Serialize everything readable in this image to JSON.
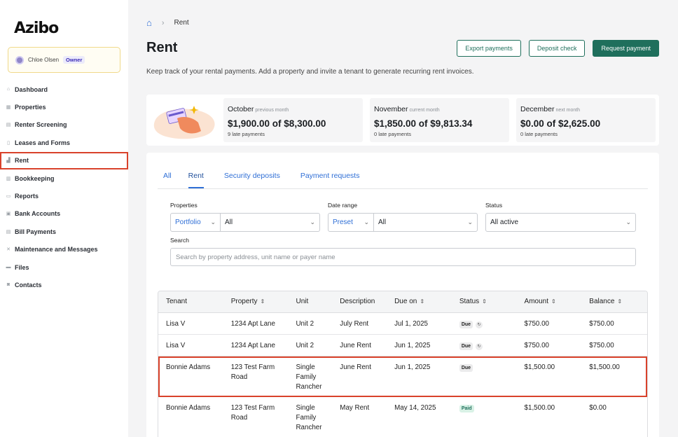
{
  "app": {
    "logo": "Azibo"
  },
  "user": {
    "name": "Chloe Olsen",
    "role": "Owner"
  },
  "sidebar": {
    "items": [
      {
        "label": "Dashboard",
        "icon": "home-icon"
      },
      {
        "label": "Properties",
        "icon": "buildings-icon"
      },
      {
        "label": "Renter Screening",
        "icon": "search-icon"
      },
      {
        "label": "Leases and Forms",
        "icon": "document-icon"
      },
      {
        "label": "Rent",
        "icon": "chart-icon"
      },
      {
        "label": "Bookkeeping",
        "icon": "book-icon"
      },
      {
        "label": "Reports",
        "icon": "report-icon"
      },
      {
        "label": "Bank Accounts",
        "icon": "bank-icon"
      },
      {
        "label": "Bill Payments",
        "icon": "bill-icon"
      },
      {
        "label": "Maintenance and Messages",
        "icon": "wrench-icon"
      },
      {
        "label": "Files",
        "icon": "folder-icon"
      },
      {
        "label": "Contacts",
        "icon": "contacts-icon"
      }
    ]
  },
  "breadcrumb": {
    "separator": "›",
    "current": "Rent"
  },
  "page": {
    "title": "Rent",
    "description": "Keep track of your rental payments. Add a property and invite a tenant to generate recurring rent invoices."
  },
  "actions": {
    "export": "Export payments",
    "deposit": "Deposit check",
    "request": "Request payment"
  },
  "summary": [
    {
      "month": "October",
      "sub": "previous month",
      "amount": "$1,900.00 of $8,300.00",
      "late": "9 late payments"
    },
    {
      "month": "November",
      "sub": "current month",
      "amount": "$1,850.00 of $9,813.34",
      "late": "0 late payments"
    },
    {
      "month": "December",
      "sub": "next month",
      "amount": "$0.00 of $2,625.00",
      "late": "0 late payments"
    }
  ],
  "tabs": [
    "All",
    "Rent",
    "Security deposits",
    "Payment requests"
  ],
  "filters": {
    "properties_label": "Properties",
    "properties_scope": "Portfolio",
    "properties_value": "All",
    "date_label": "Date range",
    "date_scope": "Preset",
    "date_value": "All",
    "status_label": "Status",
    "status_value": "All active",
    "search_label": "Search",
    "search_placeholder": "Search by property address, unit name or payer name"
  },
  "table": {
    "headers": [
      "Tenant",
      "Property",
      "Unit",
      "Description",
      "Due on",
      "Status",
      "Amount",
      "Balance"
    ],
    "rows": [
      {
        "tenant": "Lisa V",
        "property": "1234 Apt Lane",
        "unit": "Unit 2",
        "description": "July Rent",
        "due": "Jul 1, 2025",
        "status": "Due",
        "amount": "$750.00",
        "balance": "$750.00"
      },
      {
        "tenant": "Lisa V",
        "property": "1234 Apt Lane",
        "unit": "Unit 2",
        "description": "June Rent",
        "due": "Jun 1, 2025",
        "status": "Due",
        "amount": "$750.00",
        "balance": "$750.00"
      },
      {
        "tenant": "Bonnie Adams",
        "property": "123 Test Farm Road",
        "unit": "Single Family Rancher",
        "description": "June Rent",
        "due": "Jun 1, 2025",
        "status": "Due",
        "amount": "$1,500.00",
        "balance": "$1,500.00"
      },
      {
        "tenant": "Bonnie Adams",
        "property": "123 Test Farm Road",
        "unit": "Single Family Rancher",
        "description": "May Rent",
        "due": "May 14, 2025",
        "status": "Paid",
        "amount": "$1,500.00",
        "balance": "$0.00"
      }
    ]
  },
  "colors": {
    "accent": "#1f6f5c",
    "link": "#2f6fd6",
    "highlight": "#d9422b"
  }
}
